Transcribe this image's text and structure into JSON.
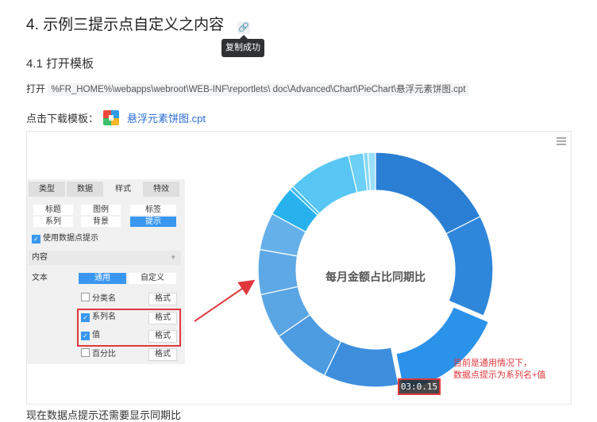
{
  "heading": {
    "title": "4. 示例三提示点自定义之内容",
    "link_icon": "link-icon"
  },
  "tooltip": {
    "text": "复制成功"
  },
  "subheading": "4.1 打开模板",
  "open_line": {
    "label": "打开",
    "path": "%FR_HOME%\\webapps\\webroot\\WEB-INF\\reportlets\\ doc\\Advanced\\Chart\\PieChart\\悬浮元素饼图.cpt"
  },
  "download_line": {
    "label": "点击下载模板：",
    "file_icon": "zip-archive-icon",
    "file_name": "悬浮元素饼图.cpt"
  },
  "panel": {
    "tabs": [
      "类型",
      "数据",
      "样式",
      "特效"
    ],
    "active_tab": "样式",
    "sub_tabs": [
      "标题",
      "图例",
      "标签",
      "系列",
      "背景",
      "提示"
    ],
    "active_sub_tab": "提示",
    "use_tooltip_label": "使用数据点提示",
    "use_tooltip_checked": true,
    "content_section": "内容",
    "text_label": "文本",
    "text_modes": [
      "通用",
      "自定义"
    ],
    "active_text_mode": "通用",
    "items": [
      {
        "label": "分类名",
        "checked": false,
        "format": "格式"
      },
      {
        "label": "系列名",
        "checked": true,
        "format": "格式"
      },
      {
        "label": "值",
        "checked": true,
        "format": "格式"
      },
      {
        "label": "百分比",
        "checked": false,
        "format": "格式"
      }
    ]
  },
  "chart_data": {
    "type": "pie",
    "title": "每月金额占比同期比",
    "slices": [
      {
        "value": 17.0,
        "color": "#2a7fd4"
      },
      {
        "value": 13.5,
        "color": "#2f87dc"
      },
      {
        "value": 15.0,
        "color": "#2b92ea"
      },
      {
        "value": 10.0,
        "color": "#3d8fdd"
      },
      {
        "value": 8.0,
        "color": "#4d9be0"
      },
      {
        "value": 6.0,
        "color": "#5aa5e4"
      },
      {
        "value": 6.0,
        "color": "#5fa8e6"
      },
      {
        "value": 5.0,
        "color": "#66b0e9"
      },
      {
        "value": 4.0,
        "color": "#27b2ee"
      },
      {
        "value": 0.5,
        "color": "#3bbcf1"
      },
      {
        "value": 8.5,
        "color": "#58c6f3"
      },
      {
        "value": 2.0,
        "color": "#6ccff5"
      },
      {
        "value": 0.6,
        "color": "#85d8f7"
      },
      {
        "value": 1.0,
        "color": "#9be0f9"
      }
    ],
    "highlighted_slice": 2,
    "tooltip_value": "03:0.15"
  },
  "annotation": {
    "lines": [
      "目前是通用情况下，",
      "数据点提示为系列名+值"
    ],
    "color": "#e0383d"
  },
  "bottom_text": "现在数据点提示还需要显示同期比"
}
